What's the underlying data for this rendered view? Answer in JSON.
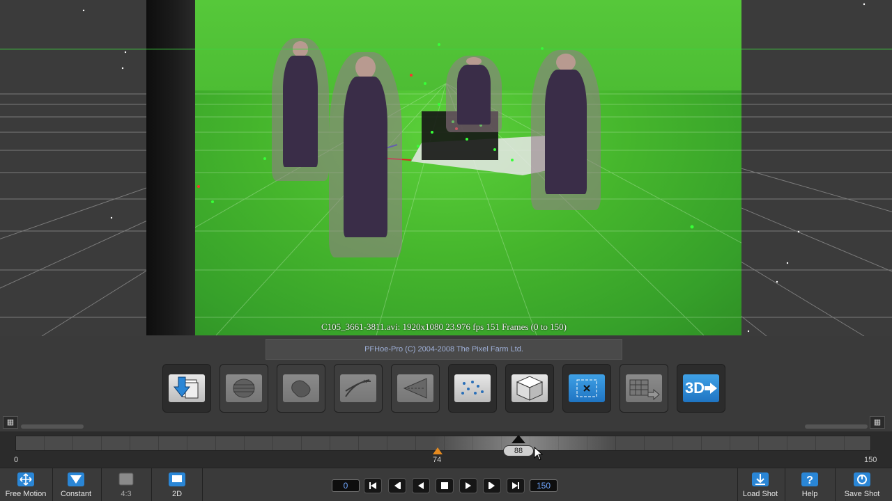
{
  "viewport": {
    "clip_info": "C105_3661-3811.avi: 1920x1080  23.976 fps  151 Frames (0 to 150)"
  },
  "copyright": "PFHoe-Pro (C) 2004-2008 The Pixel Farm Ltd.",
  "toolbar": {
    "tools": [
      {
        "icon": "import-clip-icon",
        "state": "active"
      },
      {
        "icon": "lens-distortion-icon",
        "state": "dim"
      },
      {
        "icon": "mask-icon",
        "state": "dim"
      },
      {
        "icon": "track-icon",
        "state": "dim"
      },
      {
        "icon": "camera-solve-icon",
        "state": "dim"
      },
      {
        "icon": "point-cloud-icon",
        "state": "active"
      },
      {
        "icon": "3d-cube-icon",
        "state": "active"
      },
      {
        "icon": "orient-scene-icon",
        "state": "active"
      },
      {
        "icon": "export-icon",
        "state": "dim"
      },
      {
        "icon": "3d-export-icon",
        "state": "active",
        "text": "3D"
      }
    ]
  },
  "timeline": {
    "start": "0",
    "end": "150",
    "in_marker": "74",
    "current_frame": "88",
    "colors": {
      "in_marker": "#e58a1f",
      "current": "#0d0d0d"
    }
  },
  "bottom": {
    "free_motion": "Free Motion",
    "constant": "Constant",
    "aspect": "4:3",
    "mode": "2D",
    "start_frame": "0",
    "end_frame": "150",
    "load_shot": "Load Shot",
    "help": "Help",
    "save_shot": "Save Shot"
  },
  "colors": {
    "accent_blue": "#2a86d6",
    "frame_text": "#6fa6ff",
    "green_screen": "#45b52c"
  }
}
